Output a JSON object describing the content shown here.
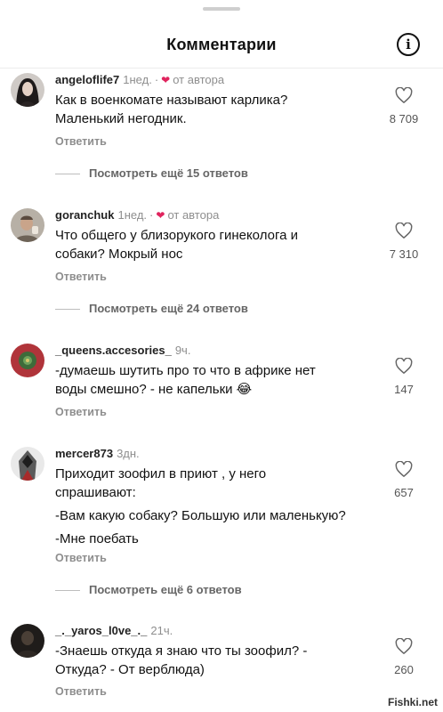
{
  "header": {
    "title": "Комментарии",
    "info_icon_glyph": "i"
  },
  "comments": [
    {
      "username": "angeloflife7",
      "time": "1нед.",
      "author_like": "от автора",
      "lines": [
        "Как в военкомате называют карлика?",
        "Маленький негодник."
      ],
      "likes": "8 709",
      "reply_label": "Ответить",
      "more_replies": "Посмотреть ещё 15 ответов",
      "avatar_icon": "woman-portrait-avatar"
    },
    {
      "username": "goranchuk",
      "time": "1нед.",
      "author_like": "от автора",
      "lines": [
        "Что общего у близорукого гинеколога и",
        "собаки? Мокрый нос"
      ],
      "likes": "7 310",
      "reply_label": "Ответить",
      "more_replies": "Посмотреть ещё 24 ответов",
      "avatar_icon": "man-portrait-avatar"
    },
    {
      "username": "_queens.accesories_",
      "time": "9ч.",
      "lines": [
        "-думаешь шутить про то что в африке нет",
        "воды смешно? - не капельки 😂"
      ],
      "likes": "147",
      "reply_label": "Ответить",
      "avatar_icon": "red-flower-avatar"
    },
    {
      "username": "mercer873",
      "time": "3дн.",
      "paragraphs": [
        "Приходит зоофил в приют , у него спрашивают:",
        "-Вам какую собаку? Большую или маленькую?",
        "-Мне поебать"
      ],
      "likes": "657",
      "reply_label": "Ответить",
      "more_replies": "Посмотреть ещё 6 ответов",
      "avatar_icon": "hooded-assassin-avatar"
    },
    {
      "username": "_._yaros_l0ve_._",
      "time": "21ч.",
      "lines": [
        "-Знаешь откуда я знаю что ты зоофил? -",
        "Откуда? - От верблюда)"
      ],
      "likes": "260",
      "reply_label": "Ответить",
      "avatar_icon": "dark-figure-avatar"
    }
  ],
  "watermark": "Fishki.net",
  "colors": {
    "heart_red": "#e0245e",
    "muted_text": "#8e8e8e",
    "text": "#111111",
    "background": "#ffffff"
  }
}
